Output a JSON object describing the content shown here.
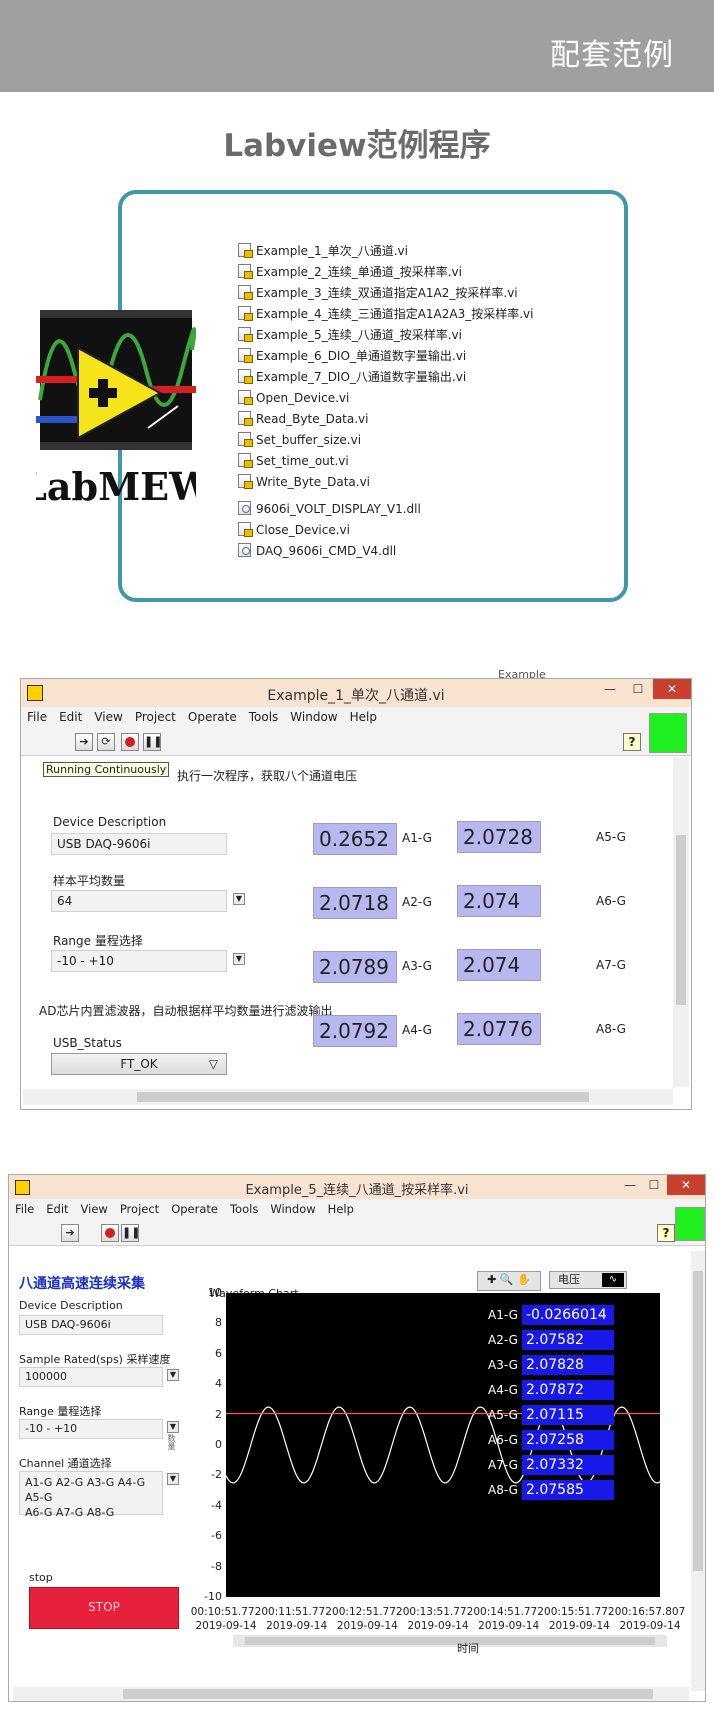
{
  "header": {
    "title": "配套范例"
  },
  "section": {
    "title": "Labview范例程序"
  },
  "logo": {
    "text": "LabMEW"
  },
  "files": [
    {
      "name": "Example_1_单次_八通道.vi",
      "kind": "vi"
    },
    {
      "name": "Example_2_连续_单通道_按采样率.vi",
      "kind": "vi"
    },
    {
      "name": "Example_3_连续_双通道指定A1A2_按采样率.vi",
      "kind": "vi"
    },
    {
      "name": "Example_4_连续_三通道指定A1A2A3_按采样率.vi",
      "kind": "vi"
    },
    {
      "name": "Example_5_连续_八通道_按采样率.vi",
      "kind": "vi"
    },
    {
      "name": "Example_6_DIO_单通道数字量输出.vi",
      "kind": "vi"
    },
    {
      "name": "Example_7_DIO_八通道数字量输出.vi",
      "kind": "vi"
    },
    {
      "name": "Open_Device.vi",
      "kind": "vi"
    },
    {
      "name": "Read_Byte_Data.vi",
      "kind": "vi"
    },
    {
      "name": "Set_buffer_size.vi",
      "kind": "vi"
    },
    {
      "name": "Set_time_out.vi",
      "kind": "vi"
    },
    {
      "name": "Write_Byte_Data.vi",
      "kind": "vi"
    },
    {
      "name": "9606i_VOLT_DISPLAY_V1.dll",
      "kind": "dll"
    },
    {
      "name": "Close_Device.vi",
      "kind": "vi"
    },
    {
      "name": "DAQ_9606i_CMD_V4.dll",
      "kind": "dll"
    }
  ],
  "win1": {
    "title": "Example_1_单次_八通道.vi",
    "behind_text": "Example",
    "menu": [
      "File",
      "Edit",
      "View",
      "Project",
      "Operate",
      "Tools",
      "Window",
      "Help"
    ],
    "tooltip": "Running Continuously",
    "instruction": "执行一次程序，获取八个通道电压",
    "device_label": "Device Description",
    "device_value": "USB DAQ-9606i",
    "avg_label": "样本平均数量",
    "avg_value": "64",
    "range_label": "Range 量程选择",
    "range_value": "-10 - +10",
    "filter_note": "AD芯片内置滤波器，自动根据样平均数量进行滤波输出",
    "status_label": "USB_Status",
    "status_value": "FT_OK",
    "channels": [
      {
        "label": "A1-G",
        "value": "0.2652"
      },
      {
        "label": "A2-G",
        "value": "2.0718"
      },
      {
        "label": "A3-G",
        "value": "2.0789"
      },
      {
        "label": "A4-G",
        "value": "2.0792"
      },
      {
        "label": "A5-G",
        "value": "2.0728"
      },
      {
        "label": "A6-G",
        "value": "2.074"
      },
      {
        "label": "A7-G",
        "value": "2.074"
      },
      {
        "label": "A8-G",
        "value": "2.0776"
      }
    ]
  },
  "win2": {
    "title": "Example_5_连续_八通道_按采样率.vi",
    "menu": [
      "File",
      "Edit",
      "View",
      "Project",
      "Operate",
      "Tools",
      "Window",
      "Help"
    ],
    "panel_title": "八通道高速连续采集",
    "device_label": "Device Description",
    "device_value": "USB DAQ-9606i",
    "rate_label": "Sample Rated(sps) 采样速度",
    "rate_value": "100000",
    "range_label": "Range 量程选择",
    "range_value": "-10 - +10",
    "range_side": "数量",
    "channel_label": "Channel 通道选择",
    "channel_value_line1": "A1-G A2-G A3-G A4-G A5-G",
    "channel_value_line2": "A6-G A7-G A8-G",
    "stop_label": "stop",
    "stop_button": "STOP",
    "chart_title": "Waveform Chart",
    "plot_legend": "电压",
    "xlabel": "时间",
    "channel_readouts": [
      {
        "label": "A1-G",
        "value": "-0.0266014"
      },
      {
        "label": "A2-G",
        "value": "2.07582"
      },
      {
        "label": "A3-G",
        "value": "2.07828"
      },
      {
        "label": "A4-G",
        "value": "2.07872"
      },
      {
        "label": "A5-G",
        "value": "2.07115"
      },
      {
        "label": "A6-G",
        "value": "2.07258"
      },
      {
        "label": "A7-G",
        "value": "2.07332"
      },
      {
        "label": "A8-G",
        "value": "2.07585"
      }
    ]
  },
  "chart_data": {
    "type": "line",
    "title": "Waveform Chart",
    "xlabel": "时间",
    "ylabel": "",
    "ylim": [
      -10,
      10
    ],
    "yticks": [
      10,
      8,
      6,
      4,
      2,
      0,
      -2,
      -4,
      -6,
      -8,
      -10
    ],
    "xticks": [
      {
        "time": "00:10:51.772",
        "date": "2019-09-14"
      },
      {
        "time": "00:11:51.772",
        "date": "2019-09-14"
      },
      {
        "time": "00:12:51.772",
        "date": "2019-09-14"
      },
      {
        "time": "00:13:51.772",
        "date": "2019-09-14"
      },
      {
        "time": "00:14:51.772",
        "date": "2019-09-14"
      },
      {
        "time": "00:15:51.772",
        "date": "2019-09-14"
      },
      {
        "time": "00:16:57.807",
        "date": "2019-09-14"
      }
    ],
    "series": [
      {
        "kind": "sine",
        "amplitude": 2.5,
        "offset": 0,
        "period_ticks": 1,
        "color": "#ffffff"
      },
      {
        "kind": "constant",
        "value": 2.07,
        "color": "#ff5a3a"
      }
    ]
  }
}
